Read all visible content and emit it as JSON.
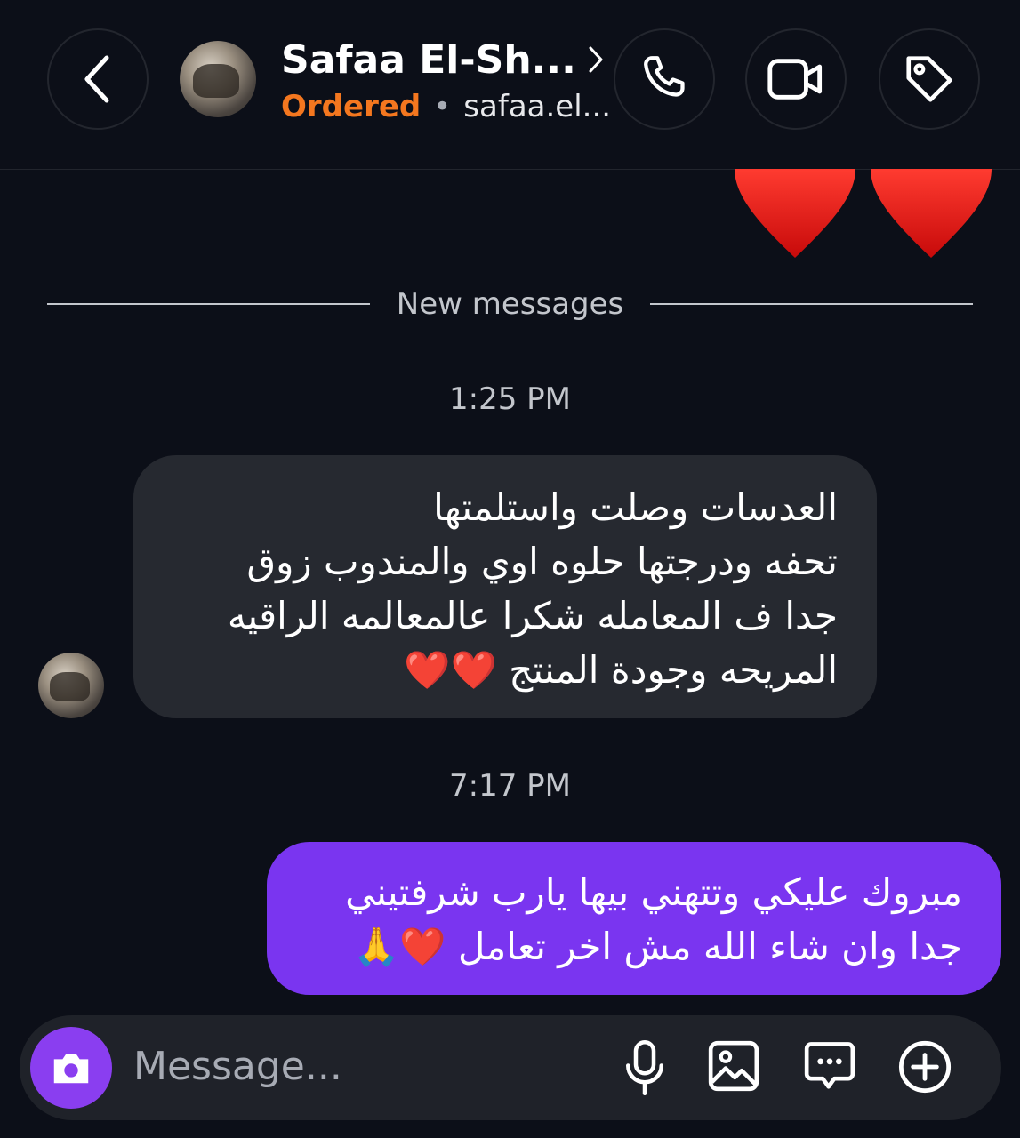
{
  "header": {
    "contact_name": "Safaa El-Sh...",
    "status": "Ordered",
    "separator": "•",
    "handle": "safaa.el..."
  },
  "thread": {
    "reactions": [
      "❤️",
      "❤️"
    ],
    "divider_label": "New messages",
    "groups": [
      {
        "time": "1:25 PM",
        "direction": "incoming",
        "text": "العدسات وصلت واستلمتها\nتحفه ودرجتها حلوه اوي والمندوب زوق\nجدا ف المعامله شكرا عالمعالمه الراقيه\nالمريحه وجودة المنتج ❤️❤️"
      },
      {
        "time": "7:17 PM",
        "direction": "outgoing",
        "text": "مبروك عليكي وتتهني بيها يارب شرفتيني\nجدا وان شاء الله مش اخر تعامل ❤️🙏"
      }
    ]
  },
  "composer": {
    "placeholder": "Message..."
  },
  "colors": {
    "background": "#0c0f18",
    "accent_orange": "#f4771f",
    "outgoing_bubble": "#7a35f0",
    "incoming_bubble": "#262930",
    "camera_button": "#8a3ef0"
  },
  "icons": {
    "back": "chevron-left-icon",
    "profile": "chevron-right-icon",
    "call": "phone-icon",
    "video": "video-camera-icon",
    "tag": "tag-icon",
    "camera": "camera-icon",
    "mic": "microphone-icon",
    "gallery": "image-icon",
    "sticker": "chat-bubble-icon",
    "more": "plus-circle-icon"
  }
}
